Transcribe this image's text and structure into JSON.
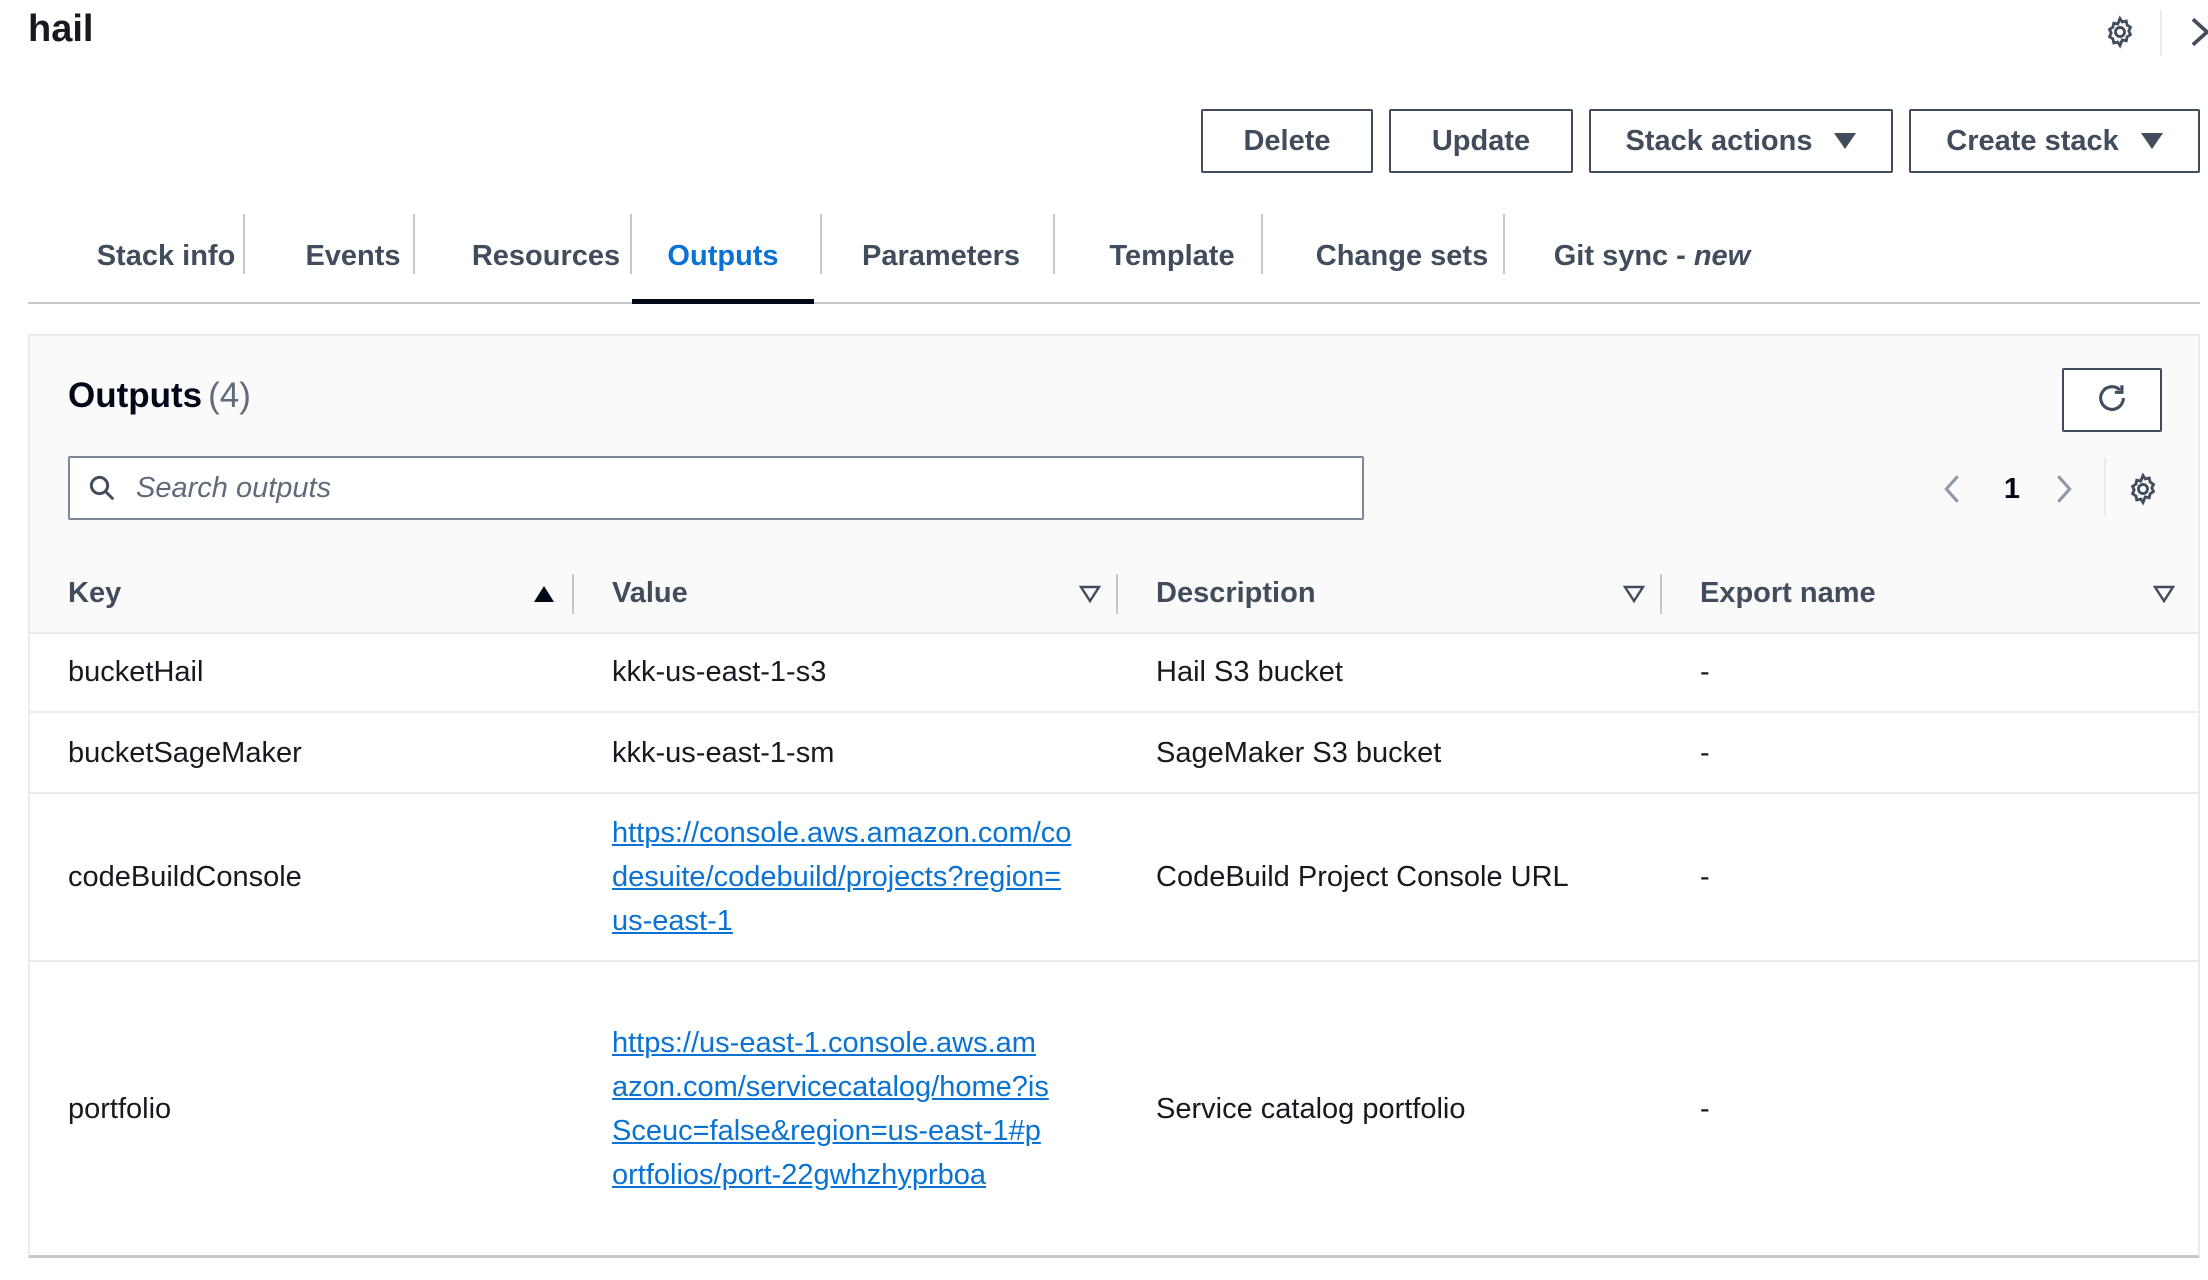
{
  "header": {
    "title": "hail",
    "gear_icon": "gear-icon",
    "close_icon": "chevron-right-icon"
  },
  "actions": {
    "delete_label": "Delete",
    "update_label": "Update",
    "stack_actions_label": "Stack actions",
    "create_stack_label": "Create stack"
  },
  "tabs": [
    {
      "label": "Stack info",
      "active": false
    },
    {
      "label": "Events",
      "active": false
    },
    {
      "label": "Resources",
      "active": false
    },
    {
      "label": "Outputs",
      "active": true
    },
    {
      "label": "Parameters",
      "active": false
    },
    {
      "label": "Template",
      "active": false
    },
    {
      "label": "Change sets",
      "active": false
    },
    {
      "label": "Git sync",
      "suffix": "new",
      "active": false
    }
  ],
  "outputs": {
    "title": "Outputs",
    "count": "(4)",
    "search_placeholder": "Search outputs",
    "search_value": "",
    "page_number": "1",
    "columns": [
      {
        "label": "Key",
        "sort": "ascending"
      },
      {
        "label": "Value",
        "sort": "none"
      },
      {
        "label": "Description",
        "sort": "none"
      },
      {
        "label": "Export name",
        "sort": "none"
      }
    ],
    "rows": [
      {
        "key": "bucketHail",
        "value": "kkk-us-east-1-s3",
        "value_is_link": false,
        "description": "Hail S3 bucket",
        "export_name": "-"
      },
      {
        "key": "bucketSageMaker",
        "value": "kkk-us-east-1-sm",
        "value_is_link": false,
        "description": "SageMaker S3 bucket",
        "export_name": "-"
      },
      {
        "key": "codeBuildConsole",
        "value": "https://console.aws.amazon.com/codesuite/codebuild/projects?region=us-east-1",
        "value_is_link": true,
        "description": "CodeBuild Project Console URL",
        "export_name": "-"
      },
      {
        "key": "portfolio",
        "value": "https://us-east-1.console.aws.amazon.com/servicecatalog/home?isSceuc=false&region=us-east-1#portfolios/port-22gwhzhyprboa",
        "value_is_link": true,
        "description": "Service catalog portfolio",
        "export_name": "-"
      }
    ]
  },
  "colors": {
    "accent": "#0972d3",
    "text": "#16191f",
    "muted": "#414d5c",
    "border": "#c6c6cd"
  }
}
